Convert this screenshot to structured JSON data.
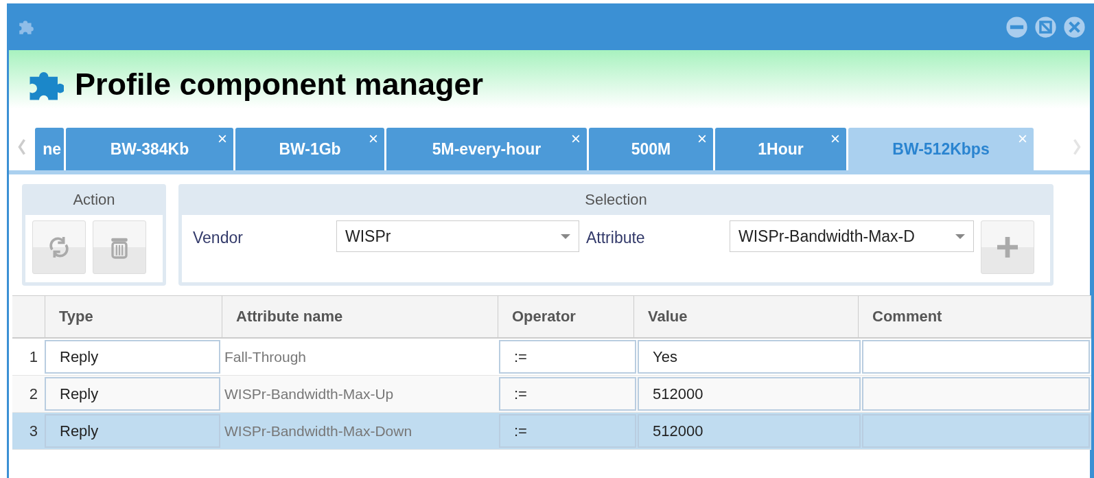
{
  "window": {
    "title": "Profile component manager"
  },
  "tabs": [
    {
      "label": "ne",
      "selected": false,
      "closable": false
    },
    {
      "label": "BW-384Kb",
      "selected": false,
      "closable": true
    },
    {
      "label": "BW-1Gb",
      "selected": false,
      "closable": true
    },
    {
      "label": "5M-every-hour",
      "selected": false,
      "closable": true
    },
    {
      "label": "500M",
      "selected": false,
      "closable": true
    },
    {
      "label": "1Hour",
      "selected": false,
      "closable": true
    },
    {
      "label": "BW-512Kbps",
      "selected": true,
      "closable": true
    }
  ],
  "action_panel": {
    "title": "Action"
  },
  "selection_panel": {
    "title": "Selection",
    "vendor_label": "Vendor",
    "vendor_value": "WISPr",
    "attribute_label": "Attribute",
    "attribute_value": "WISPr-Bandwidth-Max-D"
  },
  "table": {
    "columns": [
      "Type",
      "Attribute name",
      "Operator",
      "Value",
      "Comment"
    ],
    "rows": [
      {
        "number": "1",
        "type": "Reply",
        "attribute_name": "Fall-Through",
        "operator": ":=",
        "value": "Yes",
        "selected": false
      },
      {
        "number": "2",
        "type": "Reply",
        "attribute_name": "WISPr-Bandwidth-Max-Up",
        "operator": ":=",
        "value": "512000",
        "selected": false
      },
      {
        "number": "3",
        "type": "Reply",
        "attribute_name": "WISPr-Bandwidth-Max-Down",
        "operator": ":=",
        "value": "512000",
        "selected": true
      }
    ]
  }
}
